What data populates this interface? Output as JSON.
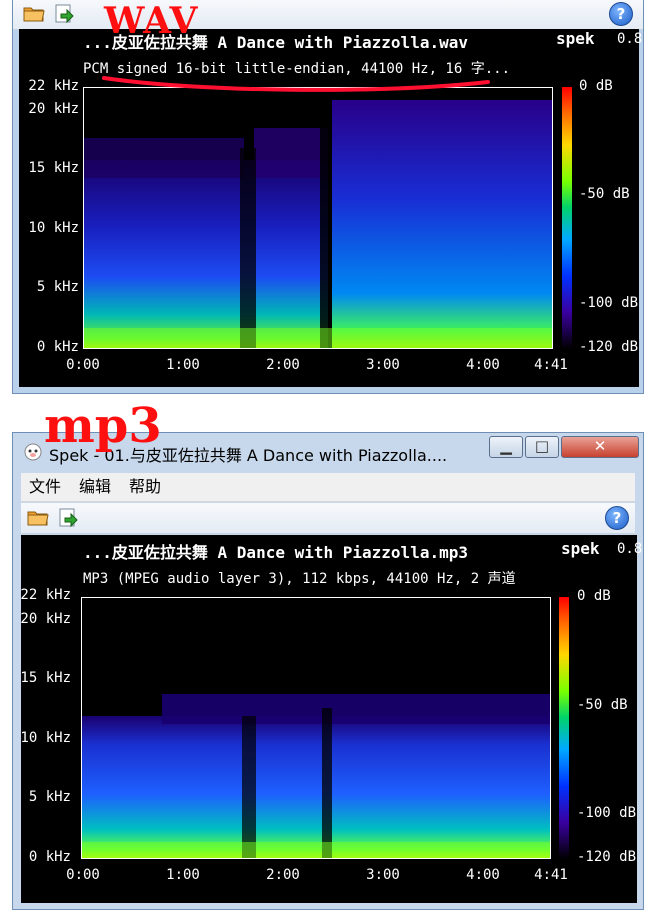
{
  "annotations": {
    "top_label": "WAV",
    "bottom_label": "mp3"
  },
  "window_top": {
    "title_line": "...皮亚佐拉共舞 A Dance with Piazzolla.wav",
    "info_line": "PCM signed 16-bit little-endian, 44100 Hz, 16 字...",
    "brand": "spek",
    "version": "0.8",
    "y_axis": [
      "22 kHz",
      "20 kHz",
      "15 kHz",
      "10 kHz",
      "5 kHz",
      "0 kHz"
    ],
    "x_axis": [
      "0:00",
      "1:00",
      "2:00",
      "3:00",
      "4:00",
      "4:41"
    ],
    "color_scale": [
      "0 dB",
      "-50 dB",
      "-100 dB",
      "-120 dB"
    ]
  },
  "window_bottom": {
    "window_title": "Spek - 01.与皮亚佐拉共舞 A Dance with Piazzolla....",
    "menu": [
      "文件",
      "编辑",
      "帮助"
    ],
    "title_line": "...皮亚佐拉共舞 A Dance with Piazzolla.mp3",
    "info_line": "MP3 (MPEG audio layer 3), 112 kbps, 44100 Hz, 2 声道",
    "brand": "spek",
    "version": "0.8",
    "y_axis": [
      "22 kHz",
      "20 kHz",
      "15 kHz",
      "10 kHz",
      "5 kHz",
      "0 kHz"
    ],
    "x_axis": [
      "0:00",
      "1:00",
      "2:00",
      "3:00",
      "4:00",
      "4:41"
    ],
    "color_scale": [
      "0 dB",
      "-50 dB",
      "-100 dB",
      "-120 dB"
    ]
  },
  "icons": {
    "open": "folder-icon",
    "save": "save-arrow-icon",
    "help": "help-icon",
    "app": "spek-app-icon",
    "minimize": "minimize-icon",
    "maximize": "maximize-icon",
    "close": "close-icon"
  },
  "colors": {
    "annotation_red": "#ff1010",
    "pane_bg": "#000000",
    "frame": "#b9d1ea"
  }
}
